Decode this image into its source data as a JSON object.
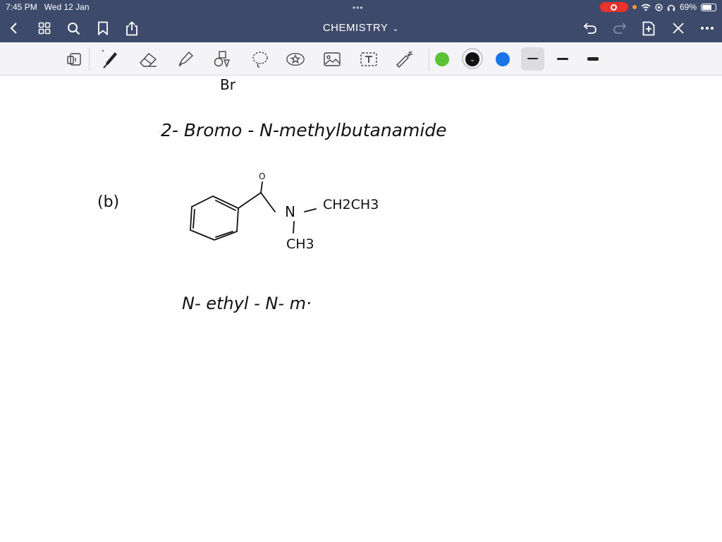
{
  "status": {
    "time": "7:45 PM",
    "date": "Wed 12 Jan",
    "battery": "69%"
  },
  "nav": {
    "title": "CHEMISTRY"
  },
  "icons": {
    "back": "chevron-left-icon",
    "grid": "thumbnails-icon",
    "search": "search-icon",
    "bookmark": "bookmark-icon",
    "share": "share-icon",
    "undo": "undo-icon",
    "redo": "redo-icon",
    "add_page": "add-page-icon",
    "close": "close-icon",
    "more": "more-icon"
  },
  "tools": [
    "read-only-icon",
    "pen-icon",
    "eraser-icon",
    "highlighter-icon",
    "shapes-icon",
    "lasso-icon",
    "sticker-icon",
    "image-icon",
    "text-icon",
    "laser-pointer-icon"
  ],
  "colors": {
    "green": "#5bc235",
    "black": "#111111",
    "blue": "#1a74e8",
    "bar_bg": "#3d4a6b"
  },
  "notes": {
    "line1": "Br",
    "line2": "2- Bromo - N-methylbutanamide",
    "part_label": "(b)",
    "oxygen": "O",
    "nitrogen": "N",
    "substituent_ethyl": "CH2CH3",
    "substituent_methyl": "CH3",
    "partial_name": "N- ethyl - N- m·"
  }
}
